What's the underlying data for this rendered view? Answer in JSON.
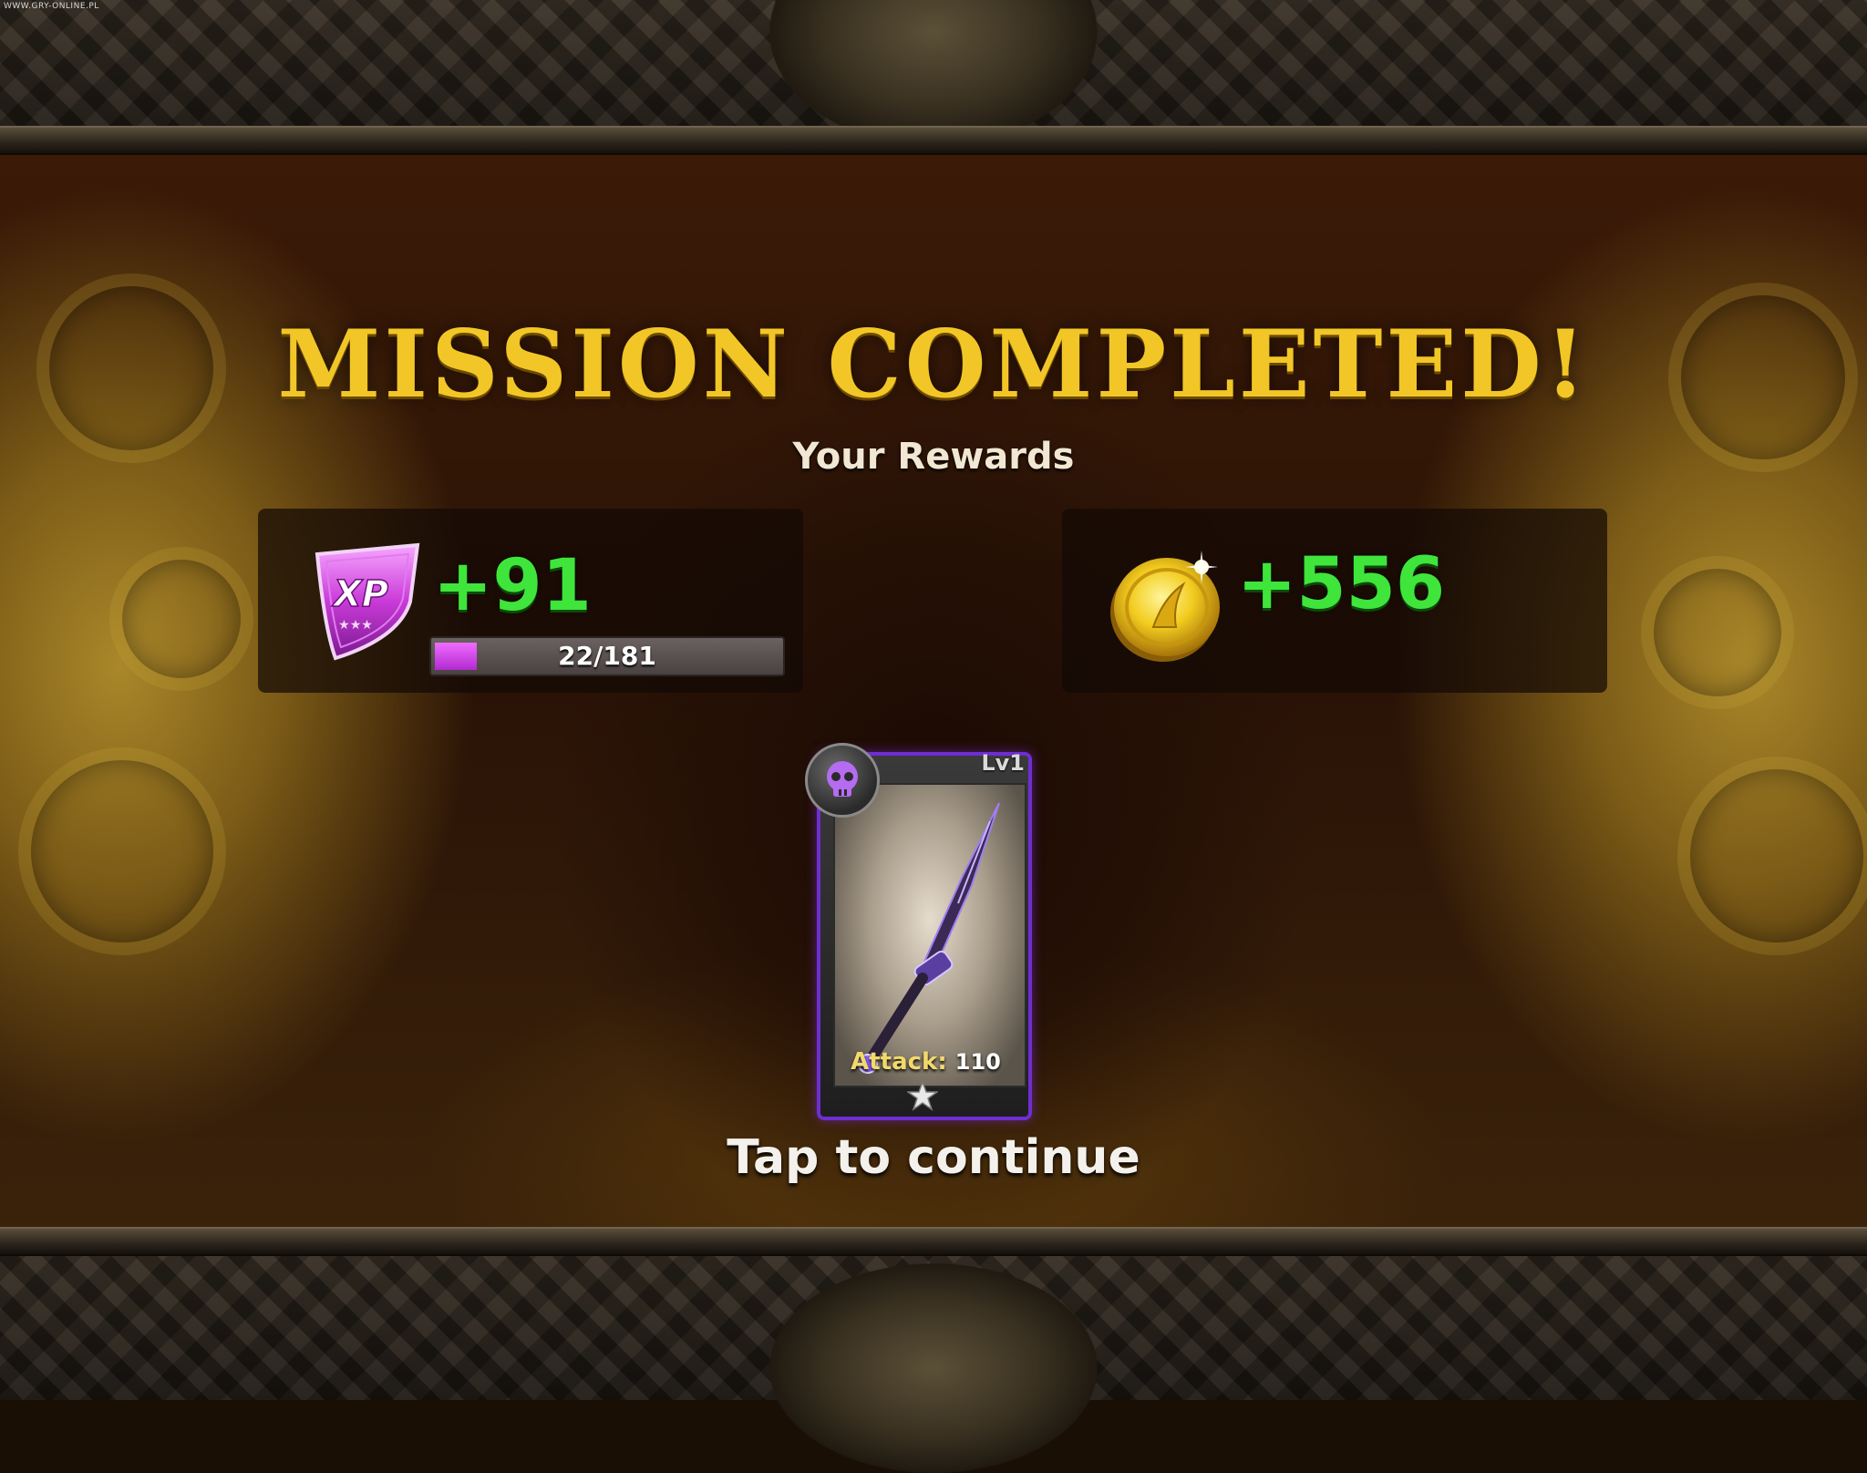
{
  "watermark": "WWW.GRY-ONLINE.PL",
  "title": "MISSION COMPLETED!",
  "subtitle": "Your Rewards",
  "xp_reward": {
    "icon": "xp-shield-icon",
    "badge_text": "XP",
    "value": "+91",
    "progress_text": "22/181",
    "progress_fraction": 0.1215
  },
  "gold_reward": {
    "icon": "gold-coin-icon",
    "value": "+556"
  },
  "item_card": {
    "level": "Lv1",
    "rarity_icon": "skull-icon",
    "item_icon": "dagger-icon",
    "stat_label": "Attack:",
    "stat_value": "110",
    "stars": 1
  },
  "continue_text": "Tap to continue",
  "colors": {
    "title": "#f2c627",
    "reward_green": "#3fe53a",
    "xp_purple": "#b22ad0",
    "card_border": "#6e2ed1"
  }
}
